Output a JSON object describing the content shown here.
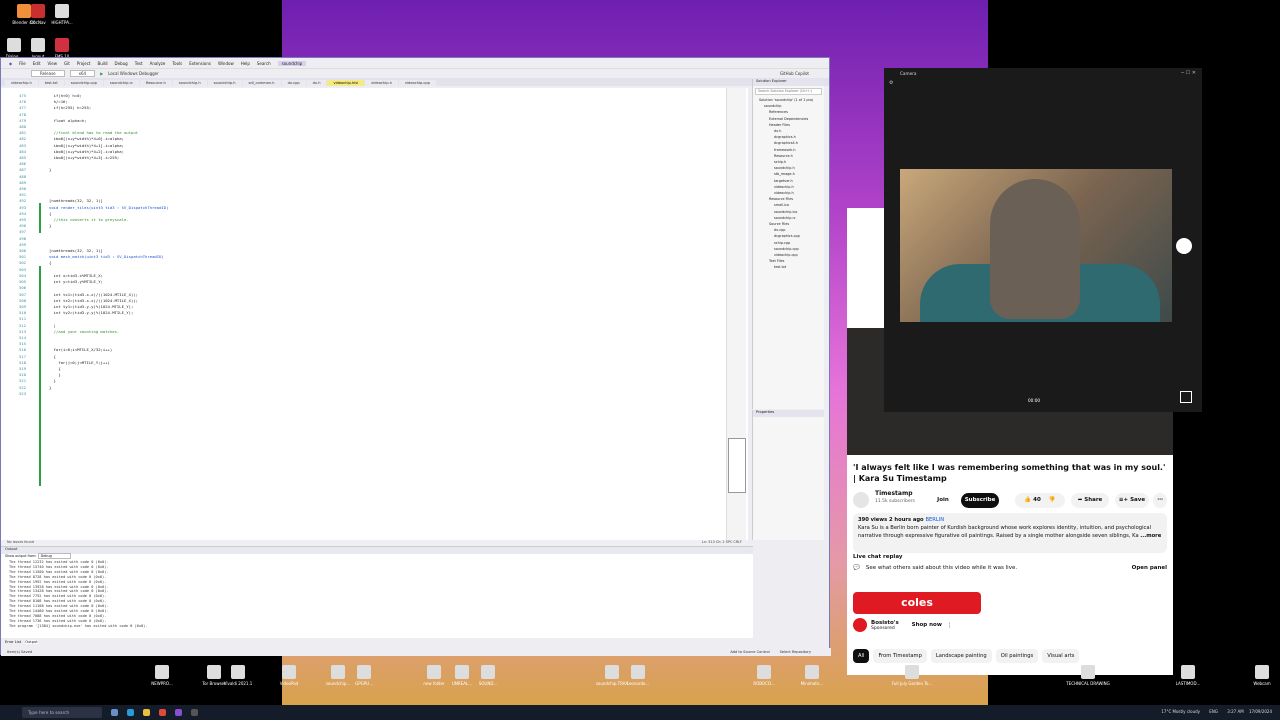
{
  "desktop": {
    "icons_top": [
      "Blender 4.0",
      "DocNav",
      "HIGHTPA..."
    ],
    "icons_row2": [
      "Dialog...",
      "logout",
      "FMS 10"
    ],
    "icons_bottom": [
      "NEWPRO...",
      "Tor Browser",
      "Vivaldi 2021.1",
      "VideoPad",
      "soundchip...",
      "GPGPU...",
      "new folder",
      "UNREAL...",
      "SOUND...",
      "soundchip.TRAX",
      "Leonardo...",
      "ROBOCO...",
      "Minimalis...",
      "Full July Garden To...",
      "TECHNICAL DRAWING",
      "LASTIMOD...",
      "Webcam"
    ]
  },
  "vs": {
    "menu": [
      "File",
      "Edit",
      "View",
      "Git",
      "Project",
      "Build",
      "Debug",
      "Test",
      "Analyze",
      "Tools",
      "Extensions",
      "Window",
      "Help",
      "Search",
      "soundchip"
    ],
    "toolbar": {
      "config": "Release",
      "platform": "x64",
      "run": "Local Windows Debugger",
      "copilot": "GitHub Copilot"
    },
    "tabs": [
      "videochip.h",
      "test.txt",
      "soundchip.cpp",
      "soundchip.rc",
      "Resource.h",
      "soundchip.h",
      "soundchip.h",
      "sdl_common.h",
      "dx.cpp",
      "dx.h",
      "videochip.hlsl",
      "videochip.h",
      "videochip.cpp"
    ],
    "active_tab": "videochip.hlsl",
    "line_numbers": [
      "475",
      "476",
      "477",
      "478",
      "479",
      "480",
      "481",
      "482",
      "483",
      "484",
      "485",
      "486",
      "487",
      "488",
      "489",
      "490",
      "491",
      "492",
      "493",
      "494",
      "495",
      "496",
      "497",
      "498",
      "499",
      "500",
      "501",
      "502",
      "503",
      "504",
      "505",
      "506",
      "507",
      "508",
      "509",
      "510",
      "511",
      "512",
      "513",
      "514",
      "515",
      "516",
      "517",
      "518",
      "519",
      "520",
      "521",
      "522",
      "523"
    ],
    "code": [
      [
        "n",
        "  if(h<0) h=0;"
      ],
      [
        "n",
        "  h/=16;"
      ],
      [
        "n",
        "  if(h>255) h=255;"
      ],
      [
        "n",
        ""
      ],
      [
        "n",
        "  float alpha=h;"
      ],
      [
        "n",
        ""
      ],
      [
        "c",
        "  //final blend has to read the output"
      ],
      [
        "n",
        "  ibo0[(x+y*width)*4+0].i=alpha;"
      ],
      [
        "n",
        "  ibo0[(x+y*width)*4+1].i=alpha;"
      ],
      [
        "n",
        "  ibo0[(x+y*width)*4+2].i=alpha;"
      ],
      [
        "n",
        "  ibo0[(x+y*width)*4+3].i=255;"
      ],
      [
        "n",
        ""
      ],
      [
        "n",
        "}"
      ],
      [
        "n",
        ""
      ],
      [
        "n",
        ""
      ],
      [
        "n",
        ""
      ],
      [
        "n",
        ""
      ],
      [
        "n",
        "[numthreads(32, 32, 1)]"
      ],
      [
        "k",
        "void render_tiles(uint3 tid3 : SV_DispatchThreadID)"
      ],
      [
        "n",
        "{"
      ],
      [
        "c",
        "  //this converts it to greyscale."
      ],
      [
        "n",
        "}"
      ],
      [
        "n",
        ""
      ],
      [
        "n",
        ""
      ],
      [
        "n",
        ""
      ],
      [
        "n",
        "[numthreads(32, 32, 1)]"
      ],
      [
        "k",
        "void mesh_match(uint3 tid3 : SV_DispatchThreadID)"
      ],
      [
        "n",
        "{"
      ],
      [
        "n",
        ""
      ],
      [
        "n",
        "  int x=tid3.x%MTILE_X;"
      ],
      [
        "n",
        "  int y=tid3.y%MTILE_Y;"
      ],
      [
        "n",
        ""
      ],
      [
        "n",
        "  int tx1=(tid3.x-x)/((1024-MTILE_X));"
      ],
      [
        "n",
        "  int tx2=(tid3.x-x)/((1024-MTILE_X));"
      ],
      [
        "n",
        "  int ty1=(tid3.y-y)%(1024-MTILE_Y);"
      ],
      [
        "n",
        "  int ty2=(tid3.y-y)%(1024-MTILE_Y);"
      ],
      [
        "n",
        ""
      ],
      [
        "n",
        "  |"
      ],
      [
        "c",
        "  //and your counting matches."
      ],
      [
        "n",
        ""
      ],
      [
        "n",
        ""
      ],
      [
        "n",
        "  for(i=0;i<MTILE_X/32;i++)"
      ],
      [
        "n",
        "  {"
      ],
      [
        "n",
        "    for(j=0;j<MTILE_Y;j++)"
      ],
      [
        "n",
        "    {"
      ],
      [
        "n",
        "    }"
      ],
      [
        "n",
        "  }"
      ],
      [
        "n",
        "}"
      ],
      [
        "n",
        ""
      ]
    ],
    "editor_status": {
      "issues": "No issues found",
      "position": "Ln: 513   Ch: 2   SPC   CRLF"
    },
    "solution": {
      "title": "Solution Explorer",
      "search": "Search Solution Explorer (Ctrl+;)",
      "items": [
        "Solution 'soundchip' (1 of 1 proj",
        "soundchip",
        "References",
        "External Dependencies",
        "Header Files",
        "dx.h",
        "dcgraphics.h",
        "dcgraphics4.h",
        "framework.h",
        "Resource.h",
        "schip.h",
        "soundchip.h",
        "stb_image.h",
        "targetver.h",
        "videochip.h",
        "videochip.h",
        "Resource Files",
        "small.ico",
        "soundchip.ico",
        "soundchip.rc",
        "Source Files",
        "dx.cpp",
        "dcgraphics.cpp",
        "schip.cpp",
        "soundchip.cpp",
        "videochip.cpp",
        "Text Files",
        "test.txt"
      ]
    },
    "properties_title": "Properties",
    "output": {
      "title": "Output",
      "source_label": "Show output from:",
      "source": "Debug",
      "lines": [
        "The thread 12232 has exited with code 0 (0x0).",
        "The thread 15740 has exited with code 0 (0x0).",
        "The thread 11500 has exited with code 0 (0x0).",
        "The thread 8728 has exited with code 0 (0x0).",
        "The thread 1992 has exited with code 0 (0x0).",
        "The thread 13928 has exited with code 0 (0x0).",
        "The thread 13428 has exited with code 0 (0x0).",
        "The thread 7752 has exited with code 0 (0x0).",
        "The thread 8108 has exited with code 0 (0x0).",
        "The thread 11108 has exited with code 0 (0x0).",
        "The thread 14480 has exited with code 0 (0x0).",
        "The thread 7088 has exited with code 0 (0x0).",
        "The thread 1736 has exited with code 0 (0x0).",
        "The program '[1384] soundchip.exe' has exited with code 0 (0x0)."
      ],
      "tabs": [
        "Error List",
        "Output"
      ]
    },
    "status": {
      "left": "Item(s) Saved",
      "add_source": "Add to Source Control",
      "repo": "Select Repository"
    }
  },
  "camera": {
    "title": "Camera",
    "timer": "00:00"
  },
  "youtube": {
    "title": "'I always felt like I was remembering something that was in my soul.' | Kara Su Timestamp",
    "channel": "Timestamp",
    "subs": "11.5k subscribers",
    "join": "Join",
    "subscribe": "Subscribe",
    "likes": "40",
    "share": "Share",
    "save": "Save",
    "views": "390 views",
    "ago": "2 hours ago",
    "tag": "BERLIN",
    "desc": "Kara Su is a Berlin born painter of Kurdish background whose work explores identity, intuition, and psychological narrative through expressive figurative oil paintings. Raised by a single mother alongside seven siblings, Ka",
    "more": "...more",
    "live_title": "Live chat replay",
    "live_text": "See what others said about this video while it was live.",
    "open_panel": "Open panel",
    "ad": {
      "brand": "coles",
      "advertiser": "Bosisto's",
      "sponsored": "Sponsored",
      "shop": "Shop now"
    },
    "chips": [
      "All",
      "From Timestamp",
      "Landscape painting",
      "Oil paintings",
      "Visual arts"
    ]
  },
  "taskbar": {
    "search": "Type here to search",
    "weather": "17°C  Mostly cloudy",
    "lang": "ENG",
    "time": "3:27 AM",
    "date": "17/09/2024"
  }
}
